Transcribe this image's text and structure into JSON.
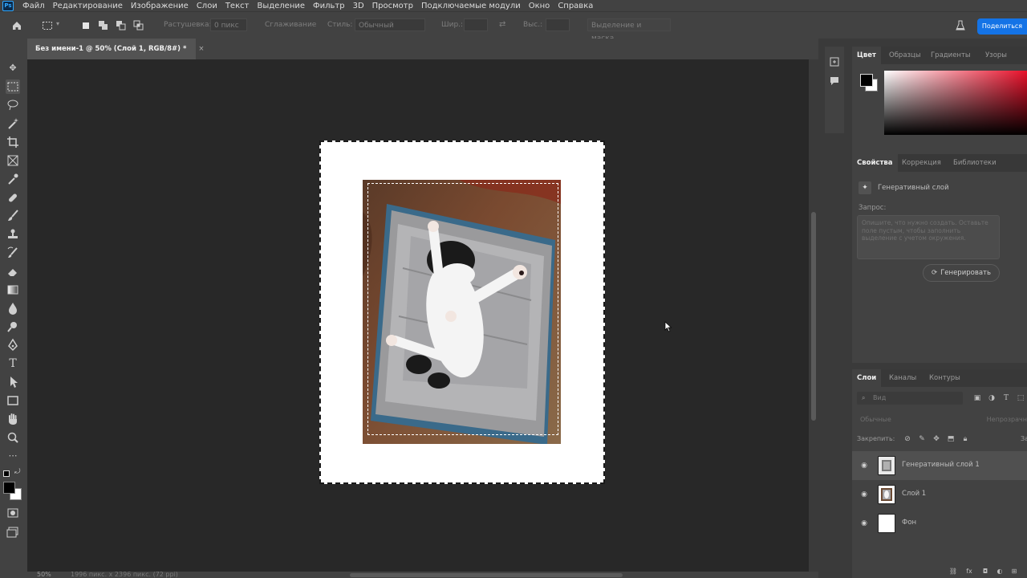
{
  "app": {
    "logo": "Ps",
    "menu": [
      "Файл",
      "Редактирование",
      "Изображение",
      "Слои",
      "Текст",
      "Выделение",
      "Фильтр",
      "3D",
      "Просмотр",
      "Подключаемые модули",
      "Окно",
      "Справка"
    ]
  },
  "options_bar": {
    "feather_label": "Растушевка:",
    "feather_value": "0 пикс",
    "antialias_label": "Сглаживание",
    "style_label": "Стиль:",
    "style_value": "Обычный",
    "width_label": "Шир.:",
    "height_label": "Выс.:",
    "select_mask_label": "Выделение и маска...",
    "share_label": "Поделиться"
  },
  "document": {
    "tab_title": "Без имени-1 @ 50% (Слой 1, RGB/8#) *",
    "zoom": "50%",
    "info": "1996 пикс. x 2396 пикс. (72 ppi)"
  },
  "color_panel": {
    "tabs": [
      "Цвет",
      "Образцы",
      "Градиенты",
      "Узоры"
    ],
    "active_tab": 0,
    "foreground": "#000000",
    "background": "#ffffff",
    "hue": "#e8102a"
  },
  "properties_panel": {
    "tabs": [
      "Свойства",
      "Коррекция",
      "Библиотеки"
    ],
    "active_tab": 0,
    "layer_type": "Генеративный слой",
    "prompt_label": "Запрос:",
    "prompt_placeholder": "Опишите, что нужно создать. Оставьте поле пустым, чтобы заполнить выделение с учетом окружения.",
    "generate_label": "Генерировать"
  },
  "layers_panel": {
    "tabs": [
      "Слои",
      "Каналы",
      "Контуры"
    ],
    "active_tab": 0,
    "search_placeholder": "Вид",
    "blend_mode": "Обычные",
    "opacity_label": "Непрозрачн",
    "lock_label": "Закрепить:",
    "fill_label": "Зал",
    "layers": [
      {
        "name": "Генеративный слой 1",
        "selected": true,
        "thumb": "generative"
      },
      {
        "name": "Слой 1",
        "selected": false,
        "thumb": "photo"
      },
      {
        "name": "Фон",
        "selected": false,
        "thumb": "white"
      }
    ]
  },
  "accent": "#1473e6"
}
